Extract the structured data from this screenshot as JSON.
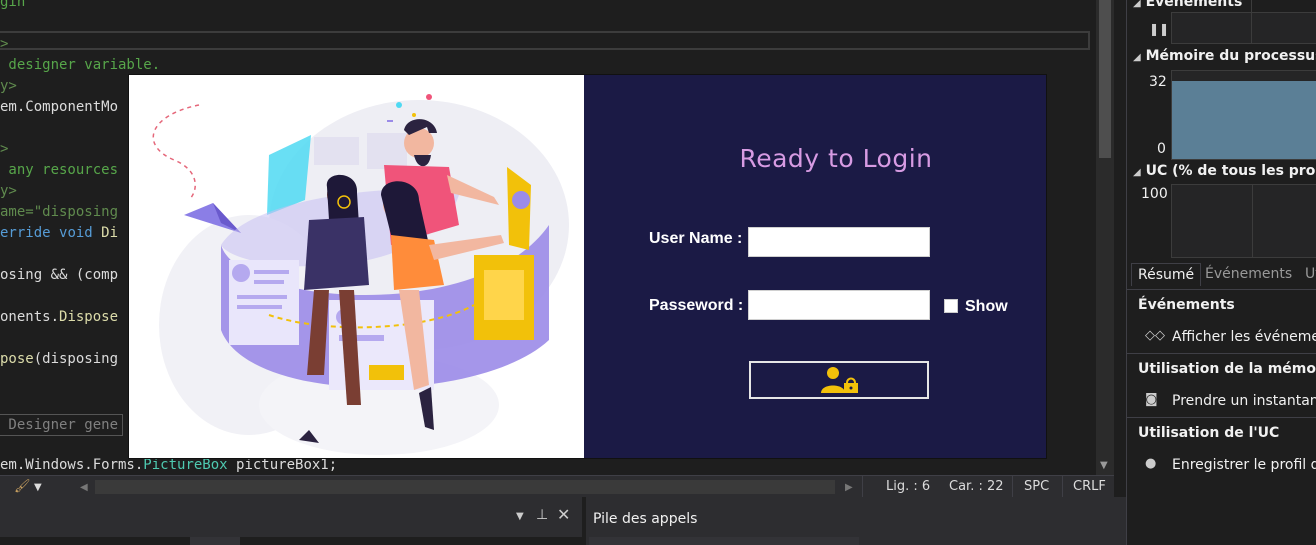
{
  "editor": {
    "lines": [
      [
        {
          "t": "gin",
          "c": "c-com"
        }
      ],
      [],
      [
        {
          "t": ">",
          "c": "c-xml"
        }
      ],
      [
        {
          "t": " designer variable.",
          "c": "c-com"
        }
      ],
      [
        {
          "t": "y>",
          "c": "c-xml"
        }
      ],
      [
        {
          "t": "em.",
          "c": "c-txt"
        },
        {
          "t": "ComponentMo",
          "c": "c-txt"
        }
      ],
      [],
      [
        {
          "t": ">",
          "c": "c-xml"
        }
      ],
      [
        {
          "t": " any resources",
          "c": "c-com"
        }
      ],
      [
        {
          "t": "y>",
          "c": "c-xml"
        }
      ],
      [
        {
          "t": "ame=\"disposing",
          "c": "c-xml"
        }
      ],
      [
        {
          "t": "erride ",
          "c": "c-kw"
        },
        {
          "t": "void ",
          "c": "c-kw"
        },
        {
          "t": "Di",
          "c": "c-fn"
        }
      ],
      [],
      [
        {
          "t": "osing && (comp",
          "c": "c-txt"
        }
      ],
      [],
      [
        {
          "t": "onents.",
          "c": "c-txt"
        },
        {
          "t": "Dispose",
          "c": "c-fn"
        }
      ],
      [],
      [
        {
          "t": "pose",
          "c": "c-fn"
        },
        {
          "t": "(disposing",
          "c": "c-txt"
        }
      ]
    ],
    "region_label": " Designer gene",
    "last_line": [
      {
        "t": "em.Windows.Forms.",
        "c": "c-txt"
      },
      {
        "t": "PictureBox",
        "c": "c-type"
      },
      {
        "t": " pictureBox1;",
        "c": "c-txt"
      }
    ]
  },
  "status": {
    "line": "Lig. : 6",
    "col": "Car. : 22",
    "spc": "SPC",
    "eol": "CRLF"
  },
  "diagnostics": {
    "events_header": "Événements",
    "memory_header": "Mémoire du processus (M",
    "memory_max": "32",
    "memory_min": "0",
    "cpu_header": "UC (% de tous les process",
    "cpu_max": "100",
    "tabs": [
      "Résumé",
      "Événements",
      "Uti"
    ],
    "sections": [
      {
        "title": "Événements",
        "item": "Afficher les événemen",
        "icon": "events-icon",
        "glyph": "◇◇"
      },
      {
        "title": "Utilisation de la mémoire",
        "item": "Prendre un instantané",
        "icon": "camera-icon",
        "glyph": "◙"
      },
      {
        "title": "Utilisation de l'UC",
        "item": "Enregistrer le profil du",
        "icon": "record-icon",
        "glyph": "●"
      }
    ]
  },
  "bottom": {
    "call_stack_title": "Pile des appels"
  },
  "login": {
    "title": "Ready to Login",
    "username_label": "User Name :",
    "username_value": "",
    "password_label": "Passeword :",
    "password_value": "",
    "show_label": "Show",
    "show_checked": false,
    "accent": "#f2c10a",
    "title_color": "#d79be3",
    "background": "#1b1a45"
  }
}
